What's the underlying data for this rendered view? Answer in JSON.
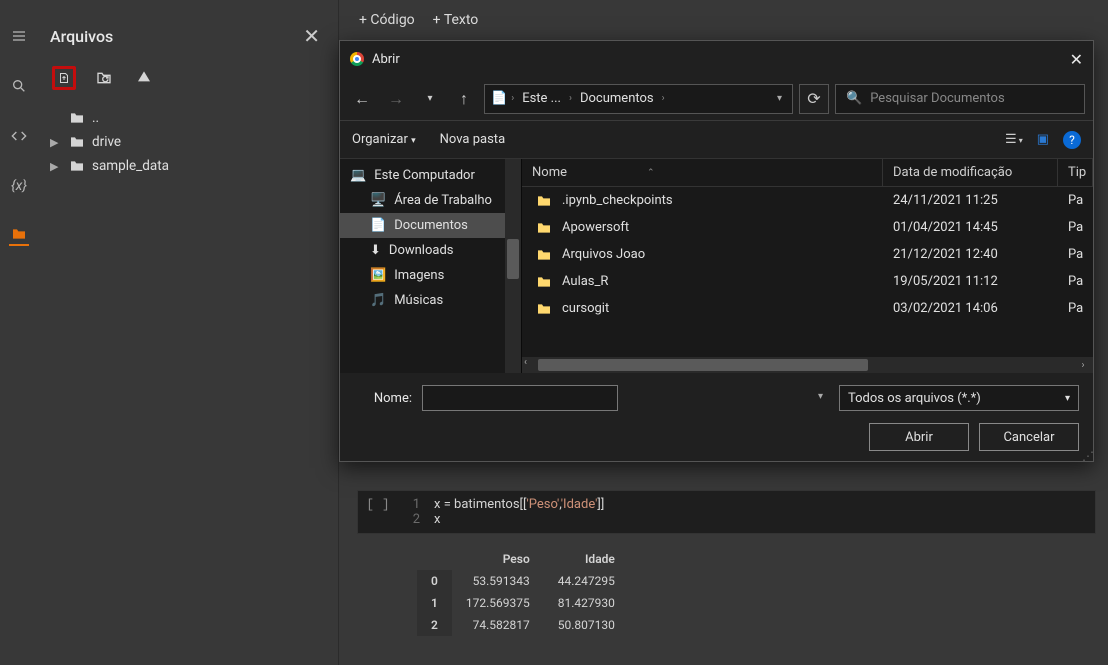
{
  "rail": {
    "items": [
      "menu",
      "search",
      "code",
      "vars",
      "folder"
    ]
  },
  "files": {
    "title": "Arquivos",
    "tree": [
      {
        "label": "..",
        "icon": "folder"
      },
      {
        "label": "drive",
        "icon": "folder",
        "expandable": true
      },
      {
        "label": "sample_data",
        "icon": "folder",
        "expandable": true
      }
    ]
  },
  "topbar": {
    "code": "+ Código",
    "text": "+ Texto"
  },
  "dialog": {
    "title": "Abrir",
    "breadcrumb": [
      "Este ...",
      "Documentos"
    ],
    "search_placeholder": "Pesquisar Documentos",
    "organize": "Organizar",
    "new_folder": "Nova pasta",
    "tree": [
      {
        "label": "Este Computador",
        "icon": "pc"
      },
      {
        "label": "Área de Trabalho",
        "icon": "desktop",
        "indent": true
      },
      {
        "label": "Documentos",
        "icon": "doc",
        "indent": true,
        "selected": true
      },
      {
        "label": "Downloads",
        "icon": "down",
        "indent": true
      },
      {
        "label": "Imagens",
        "icon": "img",
        "indent": true
      },
      {
        "label": "Músicas",
        "icon": "music",
        "indent": true
      }
    ],
    "cols": {
      "name": "Nome",
      "date": "Data de modificação",
      "type": "Tip"
    },
    "rows": [
      {
        "name": ".ipynb_checkpoints",
        "date": "24/11/2021 11:25",
        "type": "Pa"
      },
      {
        "name": "Apowersoft",
        "date": "01/04/2021 14:45",
        "type": "Pa"
      },
      {
        "name": "Arquivos Joao",
        "date": "21/12/2021 12:40",
        "type": "Pa"
      },
      {
        "name": "Aulas_R",
        "date": "19/05/2021 11:12",
        "type": "Pa"
      },
      {
        "name": "cursogit",
        "date": "03/02/2021 14:06",
        "type": "Pa"
      }
    ],
    "name_label": "Nome:",
    "filter": "Todos os arquivos (*.*)",
    "open": "Abrir",
    "cancel": "Cancelar"
  },
  "cell": {
    "code_tokens": [
      [
        {
          "t": "x ",
          "c": "var"
        },
        {
          "t": "=",
          "c": "op"
        },
        {
          "t": " batimentos[[",
          "c": "var"
        },
        {
          "t": "'Peso'",
          "c": "str"
        },
        {
          "t": ",",
          "c": "var"
        },
        {
          "t": "'Idade'",
          "c": "str"
        },
        {
          "t": "]]",
          "c": "var"
        }
      ],
      [
        {
          "t": "x",
          "c": "var"
        }
      ]
    ],
    "out_cols": [
      "Peso",
      "Idade"
    ],
    "out_rows": [
      {
        "i": "0",
        "v": [
          "53.591343",
          "44.247295"
        ]
      },
      {
        "i": "1",
        "v": [
          "172.569375",
          "81.427930"
        ]
      },
      {
        "i": "2",
        "v": [
          "74.582817",
          "50.807130"
        ]
      }
    ]
  }
}
